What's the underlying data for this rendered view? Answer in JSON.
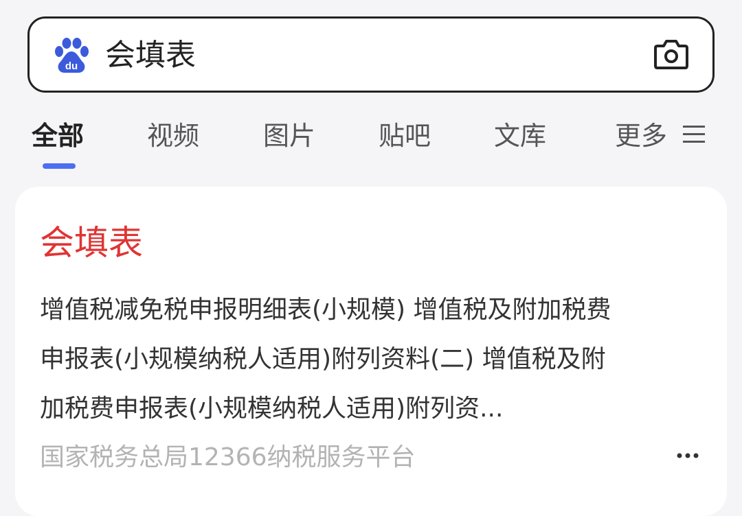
{
  "search": {
    "query": "会填表",
    "logo_icon": "baidu-paw-logo",
    "camera_icon": "camera-icon",
    "brand_color": "#3b5bdb"
  },
  "tabs": [
    {
      "label": "全部",
      "active": true
    },
    {
      "label": "视频",
      "active": false
    },
    {
      "label": "图片",
      "active": false
    },
    {
      "label": "贴吧",
      "active": false
    },
    {
      "label": "文库",
      "active": false
    },
    {
      "label": "更多",
      "active": false
    }
  ],
  "tab_menu_icon": "menu-lines-icon",
  "indicator_color": "#4e6ef2",
  "result": {
    "title": "会填表",
    "title_color": "#e03434",
    "snippet_lines": [
      "增值税减免税申报明细表(小规模) 增值税及附加税费",
      "申报表(小规模纳税人适用)附列资料(二) 增值税及附",
      "加税费申报表(小规模纳税人适用)附列资..."
    ],
    "source": "国家税务总局12366纳税服务平台",
    "more_icon": "more-dots-icon"
  }
}
